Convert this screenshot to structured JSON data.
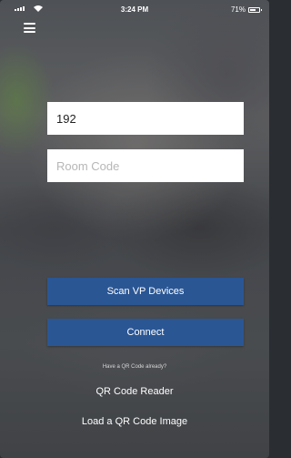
{
  "status_bar": {
    "time": "3:24 PM",
    "battery_text": "71%",
    "battery_level": 0.71
  },
  "menu": {
    "icon": "hamburger-menu-icon"
  },
  "form": {
    "ip_value": "192",
    "room_code_value": "",
    "room_code_placeholder": "Room Code"
  },
  "buttons": {
    "scan_label": "Scan VP Devices",
    "connect_label": "Connect",
    "color": "#2a5694"
  },
  "qr": {
    "hint": "Have a QR Code already?",
    "reader_label": "QR Code Reader",
    "load_label": "Load a QR Code Image"
  }
}
